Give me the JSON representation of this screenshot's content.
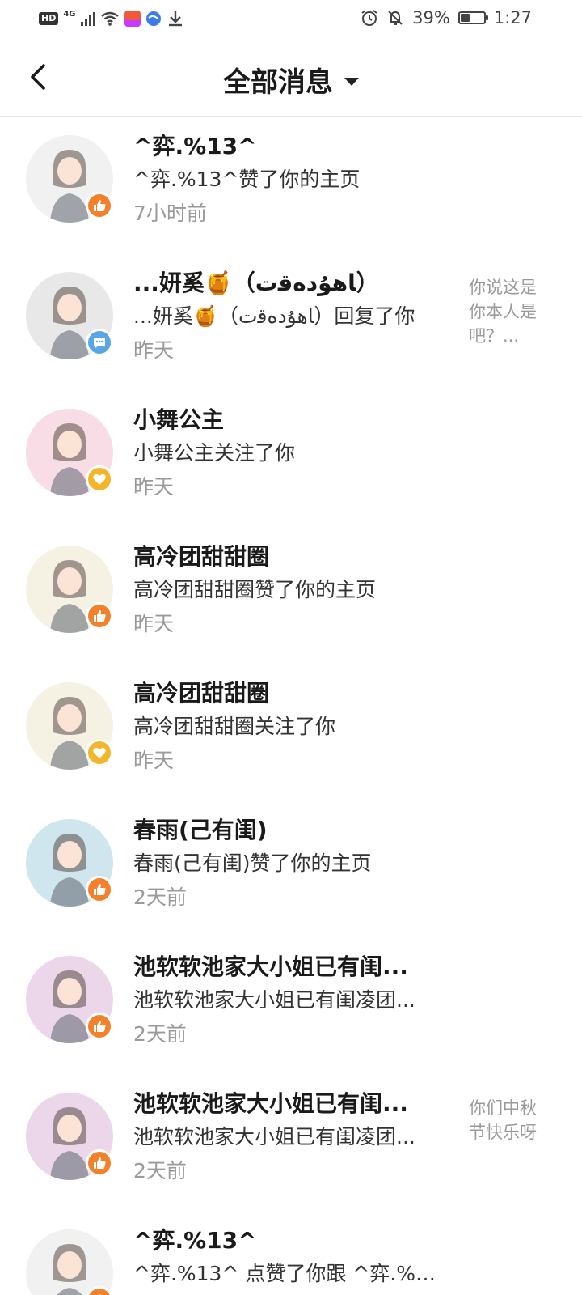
{
  "status_bar": {
    "hd": "HD",
    "network": "4G",
    "battery_pct": "39%",
    "battery_level": 0.39,
    "time": "1:27",
    "icons": [
      "hd-icon",
      "signal-icon",
      "wifi-icon",
      "app-notification-icon",
      "browser-icon",
      "download-icon",
      "alarm-icon",
      "mute-icon",
      "battery-icon"
    ]
  },
  "header": {
    "title": "全部消息",
    "back_icon": "chevron-left-icon",
    "dropdown_icon": "caret-down-icon"
  },
  "colors": {
    "like_badge": "#f5802a",
    "comment_badge": "#58a6e6",
    "follow_badge": "#f5b52a"
  },
  "messages": [
    {
      "name": "^弈.%13^",
      "desc": "^弈.%13^赞了你的主页",
      "time": "7小时前",
      "snippet": "",
      "badge": "like",
      "avatar_bg": "#f1f1f1"
    },
    {
      "name": "...妍奚🍯（ﺎﻫﯘﺩﻩﻗﺕ）",
      "desc": "...妍奚🍯（ﺎﻫﯘﺩﻩﻗﺕ）回复了你",
      "time": "昨天",
      "snippet": "你说这是你本人是吧？...",
      "badge": "comment",
      "avatar_bg": "#e8e8e8"
    },
    {
      "name": "小舞公主",
      "desc": "小舞公主关注了你",
      "time": "昨天",
      "snippet": "",
      "badge": "follow",
      "avatar_bg": "#f8dde6"
    },
    {
      "name": "高冷团甜甜圈",
      "desc": "高冷团甜甜圈赞了你的主页",
      "time": "昨天",
      "snippet": "",
      "badge": "like",
      "avatar_bg": "#f5f2e4"
    },
    {
      "name": "高冷团甜甜圈",
      "desc": "高冷团甜甜圈关注了你",
      "time": "昨天",
      "snippet": "",
      "badge": "follow",
      "avatar_bg": "#f5f2e4"
    },
    {
      "name": "春雨(己有闺)",
      "desc": "春雨(己有闺)赞了你的主页",
      "time": "2天前",
      "snippet": "",
      "badge": "like",
      "avatar_bg": "#cfe6ee"
    },
    {
      "name": "池软软池家大小姐已有闺...",
      "desc": "池软软池家大小姐已有闺凌团...",
      "time": "2天前",
      "snippet": "",
      "badge": "like",
      "avatar_bg": "#ecd6ea"
    },
    {
      "name": "池软软池家大小姐已有闺...",
      "desc": "池软软池家大小姐已有闺凌团...",
      "time": "2天前",
      "snippet": "你们中秋节快乐呀",
      "badge": "like",
      "avatar_bg": "#ecd6ea"
    },
    {
      "name": "^弈.%13^",
      "desc": "^弈.%13^ 点赞了你跟 ^弈.%13...",
      "time": "",
      "snippet": "",
      "badge": "like",
      "avatar_bg": "#f1f1f1"
    }
  ]
}
